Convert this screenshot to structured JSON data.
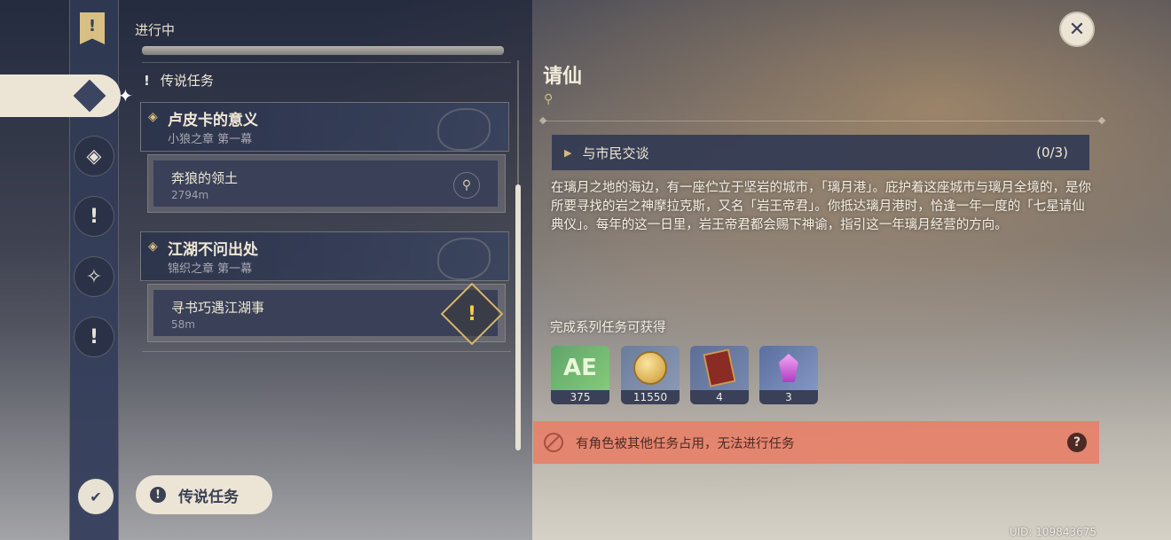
{
  "list": {
    "status_label": "进行中",
    "category_title": "传说任务",
    "groups": [
      {
        "title": "卢皮卡的意义",
        "subtitle": "小狼之章 第一幕",
        "quest": {
          "name": "奔狼的领土",
          "distance": "2794m"
        }
      },
      {
        "title": "江湖不问出处",
        "subtitle": "锦织之章 第一幕",
        "quest": {
          "name": "寻书巧遇江湖事",
          "distance": "58m"
        }
      }
    ],
    "filter_button_label": "传说任务"
  },
  "detail": {
    "title": "请仙",
    "objective": {
      "text": "与市民交谈",
      "progress": "(0/3)"
    },
    "description": "在璃月之地的海边，有一座伫立于坚岩的城市，「璃月港」。庇护着这座城市与璃月全境的，是你所要寻找的岩之神摩拉克斯，又名「岩王帝君」。你抵达璃月港时，恰逢一年一度的「七星请仙典仪」。每年的这一日里，岩王帝君都会赐下神谕，指引这一年璃月经营的方向。",
    "reward_label": "完成系列任务可获得",
    "rewards": [
      {
        "icon": "adventure-exp-icon",
        "count": "375"
      },
      {
        "icon": "mora-coin-icon",
        "count": "11550"
      },
      {
        "icon": "book-icon",
        "count": "4"
      },
      {
        "icon": "crystal-icon",
        "count": "3"
      }
    ],
    "warning": "有角色被其他任务占用，无法进行任务"
  },
  "footer": {
    "uid": "UID: 109843675"
  },
  "colors": {
    "warning_bg": "#e88068",
    "accent_gold": "#d6bb80",
    "panel_dark": "#394058"
  }
}
